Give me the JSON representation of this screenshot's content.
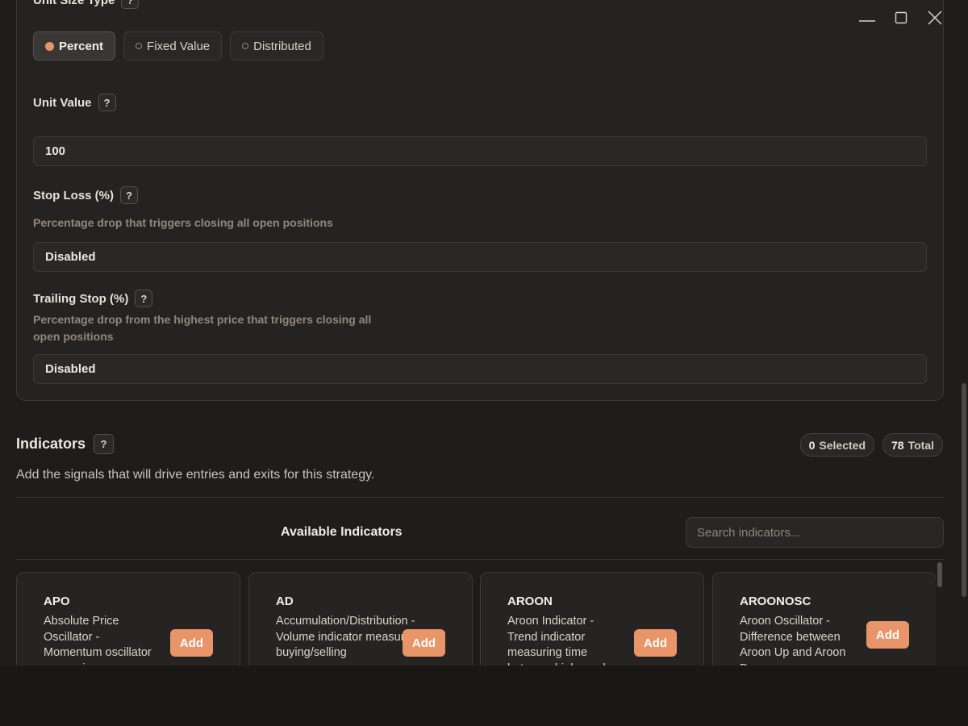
{
  "window": {
    "minimize_label": "—",
    "maximize_label": "▢",
    "close_label": "✕"
  },
  "settings": {
    "unit_size_type": {
      "label": "Unit Size Type",
      "options": [
        {
          "label": "Percent",
          "selected": true
        },
        {
          "label": "Fixed Value",
          "selected": false
        },
        {
          "label": "Distributed",
          "selected": false
        }
      ]
    },
    "unit_value": {
      "label": "Unit Value",
      "value": "100"
    },
    "stop_loss": {
      "label": "Stop Loss (%)",
      "hint": "Percentage drop that triggers closing all open positions",
      "value": "Disabled"
    },
    "trailing_stop": {
      "label": "Trailing Stop (%)",
      "hint_line1": "Percentage drop from the highest price that triggers closing all",
      "hint_line2": "open positions",
      "value": "Disabled"
    },
    "help_label": "?"
  },
  "indicators": {
    "title": "Indicators",
    "selected_count": "0",
    "selected_label": "Selected",
    "total_count": "78",
    "total_label": "Total",
    "description": "Add the signals that will drive entries and exits for this strategy.",
    "available_title": "Available Indicators",
    "search_placeholder": "Search indicators...",
    "add_label": "Add",
    "items": [
      {
        "name": "APO",
        "desc": "Absolute Price Oscillator - Momentum oscillator measuring"
      },
      {
        "name": "AD",
        "desc": "Accumulation/Distribution - Volume indicator measuring buying/selling"
      },
      {
        "name": "AROON",
        "desc": "Aroon Indicator - Trend indicator measuring time between highs and"
      },
      {
        "name": "AROONOSC",
        "desc": "Aroon Oscillator - Difference between Aroon Up and Aroon Down"
      }
    ]
  },
  "colors": {
    "accent": "#e9956a",
    "background": "#1e1d1c",
    "card": "#252322"
  }
}
